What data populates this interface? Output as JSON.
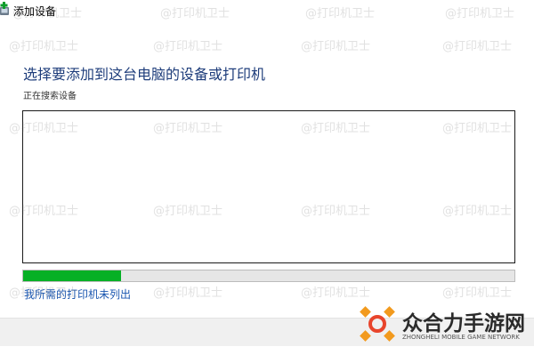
{
  "window": {
    "title": "添加设备",
    "heading": "选择要添加到这台电脑的设备或打印机",
    "status": "正在搜索设备",
    "link": "我所需的打印机未列出"
  },
  "progress": {
    "value": 0.2
  },
  "watermark": {
    "text": "@打印机卫士"
  },
  "logo": {
    "name": "众合力手游网",
    "tagline": "ZHONGHELI MOBILE GAME NETWORK"
  },
  "colors": {
    "heading": "#1e3d7b",
    "link": "#1a56b0",
    "progress_fill": "#06b025",
    "progress_track": "#e6e6e6",
    "logo_orange": "#f29a1e",
    "logo_red": "#e8452c"
  },
  "icons": {
    "title": "add-device-icon"
  }
}
